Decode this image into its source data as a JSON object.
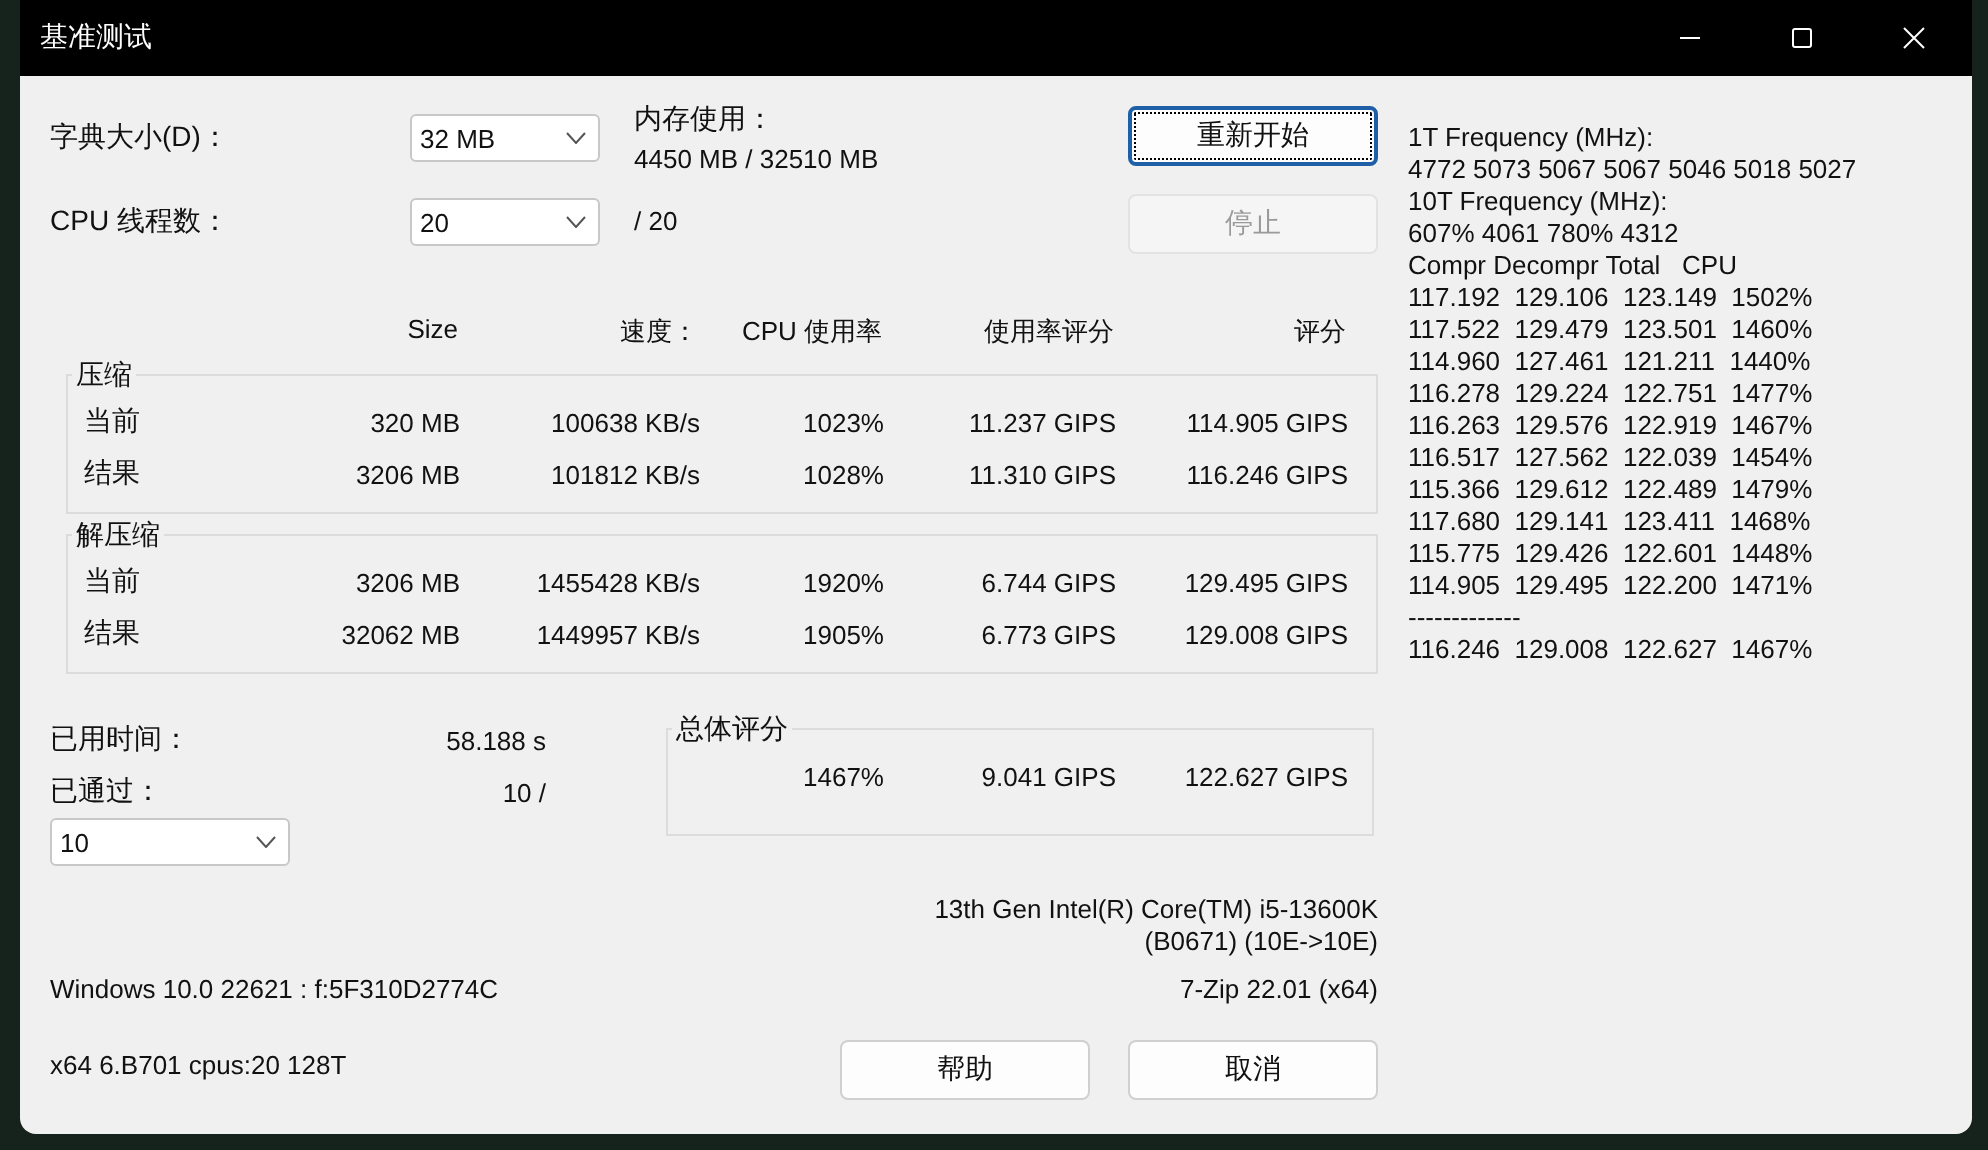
{
  "window": {
    "title": "基准测试"
  },
  "settings": [
    {
      "label": "字典大小(D)：",
      "value": "32 MB"
    },
    {
      "label": "CPU 线程数：",
      "value": "20"
    }
  ],
  "memory": {
    "label": "内存使用：",
    "value": "4450 MB / 32510 MB"
  },
  "threads_total": "/ 20",
  "buttons": [
    {
      "label": "重新开始",
      "disabled": false,
      "focused": true
    },
    {
      "label": "停止",
      "disabled": true,
      "focused": false
    }
  ],
  "columns": [
    "Size",
    "速度：",
    "CPU 使用率",
    "使用率评分",
    "评分"
  ],
  "groups": [
    {
      "title": "压缩",
      "rows": [
        {
          "label": "当前",
          "cells": [
            "320 MB",
            "100638 KB/s",
            "1023%",
            "11.237 GIPS",
            "114.905 GIPS"
          ]
        },
        {
          "label": "结果",
          "cells": [
            "3206 MB",
            "101812 KB/s",
            "1028%",
            "11.310 GIPS",
            "116.246 GIPS"
          ]
        }
      ]
    },
    {
      "title": "解压缩",
      "rows": [
        {
          "label": "当前",
          "cells": [
            "3206 MB",
            "1455428 KB/s",
            "1920%",
            "6.744 GIPS",
            "129.495 GIPS"
          ]
        },
        {
          "label": "结果",
          "cells": [
            "32062 MB",
            "1449957 KB/s",
            "1905%",
            "6.773 GIPS",
            "129.008 GIPS"
          ]
        }
      ]
    }
  ],
  "elapsed": {
    "label": "已用时间：",
    "value": "58.188 s"
  },
  "passes": {
    "label": "已通过：",
    "value": "10 /",
    "select": "10"
  },
  "total": {
    "title": "总体评分",
    "cells": [
      "1467%",
      "9.041 GIPS",
      "122.627 GIPS"
    ]
  },
  "cpu_info": [
    "13th Gen Intel(R) Core(TM) i5-13600K",
    "(B0671) (10E->10E)"
  ],
  "system": "Windows 10.0 22621 : f:5F310D2774C",
  "version": "7-Zip 22.01 (x64)",
  "build": "x64 6.B701 cpus:20 128T",
  "footer_buttons": [
    "帮助",
    "取消"
  ],
  "log": [
    "1T Frequency (MHz):",
    "4772 5073 5067 5067 5046 5018 5027",
    "10T Frequency (MHz):",
    "607% 4061 780% 4312",
    "Compr Decompr Total   CPU",
    "117.192  129.106  123.149  1502%",
    "117.522  129.479  123.501  1460%",
    "114.960  127.461  121.211  1440%",
    "116.278  129.224  122.751  1477%",
    "116.263  129.576  122.919  1467%",
    "116.517  127.562  122.039  1454%",
    "115.366  129.612  122.489  1479%",
    "117.680  129.141  123.411  1468%",
    "115.775  129.426  122.601  1448%",
    "114.905  129.495  122.200  1471%",
    "-------------",
    "116.246  129.008  122.627  1467%"
  ]
}
